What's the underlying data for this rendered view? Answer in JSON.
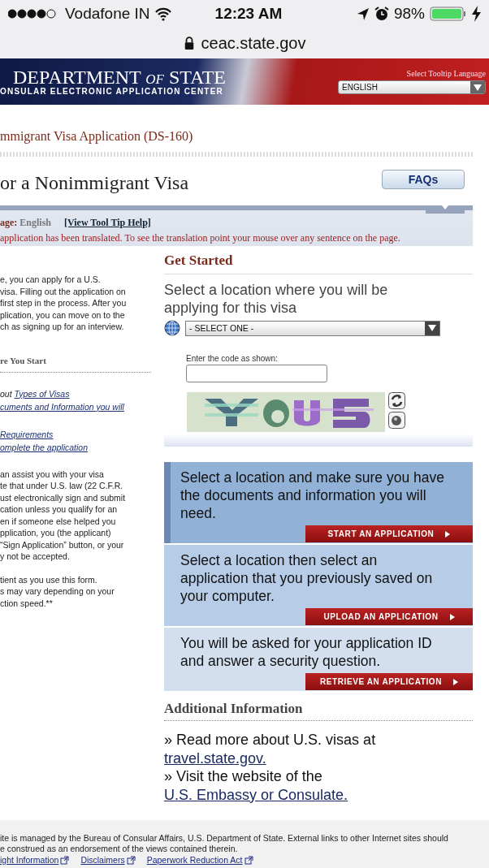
{
  "status_bar": {
    "carrier": "Vodafone IN",
    "time": "12:23 AM",
    "battery": "98%"
  },
  "address_bar": {
    "url": "ceac.state.gov"
  },
  "banner": {
    "title": "DEPARTMENT *of* STATE",
    "subtitle": "ONSULAR ELECTRONIC APPLICATION CENTER",
    "language_label": "Select Tooltip Language",
    "language_value": "ENGLISH"
  },
  "breadcrumb": "mmigrant Visa Application (DS-160)",
  "page_title": "or a Nonimmigrant Visa",
  "faq_button": "FAQs",
  "language_bar": {
    "label": "age:",
    "value": "English",
    "help_link": "[View Tool Tip Help]",
    "notice": "application has been translated. To see the translation point your mouse over any sentence on the page."
  },
  "sidebar": {
    "intro": "e, you can apply for a U.S.\nvisa. Filling out the application on\nfirst step in the process. After you\nplication, you can move on to the\nch as signing up for an interview.",
    "heading": "re You Start",
    "links": [
      {
        "prefix": "out ",
        "link": "Types of Visas"
      },
      {
        "link": "cuments and Information you will"
      },
      {
        "link": "Requirements"
      },
      {
        "link": "omplete the application"
      }
    ],
    "notes": [
      "an assist you with your visa\nte that under U.S. law (22 C.F.R.\nust electronically sign and submit\ncation unless you qualify for an\nen if someone else helped you\npplication, you (the applicant)\n“Sign Application” button, or your\ny not be accepted.",
      "tient as you use this form.\ns may vary depending on your\nction speed.**"
    ]
  },
  "get_started": {
    "heading": "Get Started",
    "location_prompt": "Select a location where you will be applying for this visa",
    "location_select": "- SELECT ONE -",
    "code_label": "Enter the code as shown:"
  },
  "options": [
    {
      "text": "Select a location and make sure you have the documents and information you will need.",
      "button": "START AN APPLICATION",
      "color": "#92b1d6"
    },
    {
      "text": "Select a location then select an application that you previously saved on your computer.",
      "button": "UPLOAD AN APPLICATION",
      "color": "#b7cce6"
    },
    {
      "text": "You will be asked for your application ID and answer a security question.",
      "button": "RETRIEVE AN APPLICATION",
      "color": "#d3dfee"
    }
  ],
  "additional_info": {
    "heading": "Additional Information",
    "lines": [
      {
        "prefix": "» Read more about U.S. visas at ",
        "link": "travel.state.gov."
      },
      {
        "prefix": "» Visit the website of the ",
        "link": "U.S. Embassy or Consulate."
      }
    ]
  },
  "footer": {
    "text": "ite is managed by the Bureau of Consular Affairs, U.S. Department of State. External links to other Internet sites should\ne construed as an endorsement of the views contained therein.",
    "links": [
      "ight Information",
      "Disclaimers",
      "Paperwork Reduction Act"
    ]
  }
}
